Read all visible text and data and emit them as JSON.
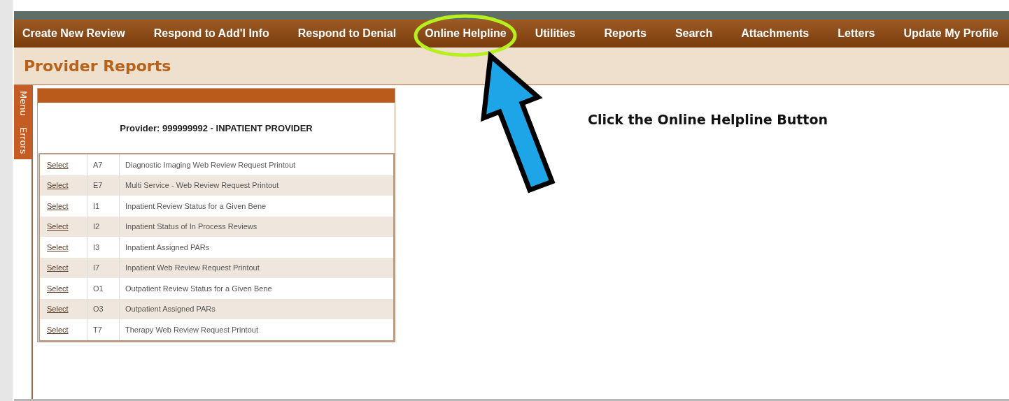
{
  "nav": [
    "Create New Review",
    "Respond to Add'l Info",
    "Respond to Denial",
    "Online Helpline",
    "Utilities",
    "Reports",
    "Search",
    "Attachments",
    "Letters",
    "Update My Profile"
  ],
  "page_title": "Provider Reports",
  "side_tabs": [
    "Menu",
    "Errors"
  ],
  "report_panel": {
    "header": "Provider: 999999992 - INPATIENT PROVIDER",
    "rows": [
      {
        "link": "Select",
        "code": "A7",
        "description": "Diagnostic Imaging Web Review Request Printout"
      },
      {
        "link": "Select",
        "code": "E7",
        "description": "Multi Service - Web Review Request Printout"
      },
      {
        "link": "Select",
        "code": "I1",
        "description": "Inpatient Review Status for a Given Bene"
      },
      {
        "link": "Select",
        "code": "I2",
        "description": "Inpatient Status of In Process Reviews"
      },
      {
        "link": "Select",
        "code": "I3",
        "description": "Inpatient Assigned PARs"
      },
      {
        "link": "Select",
        "code": "I7",
        "description": "Inpatient Web Review Request Printout"
      },
      {
        "link": "Select",
        "code": "O1",
        "description": "Outpatient Review Status for a Given Bene"
      },
      {
        "link": "Select",
        "code": "O3",
        "description": "Outpatient Assigned PARs"
      },
      {
        "link": "Select",
        "code": "T7",
        "description": "Therapy Web Review Request Printout"
      }
    ]
  },
  "annotation": {
    "caption": "Click the Online Helpline Button"
  }
}
